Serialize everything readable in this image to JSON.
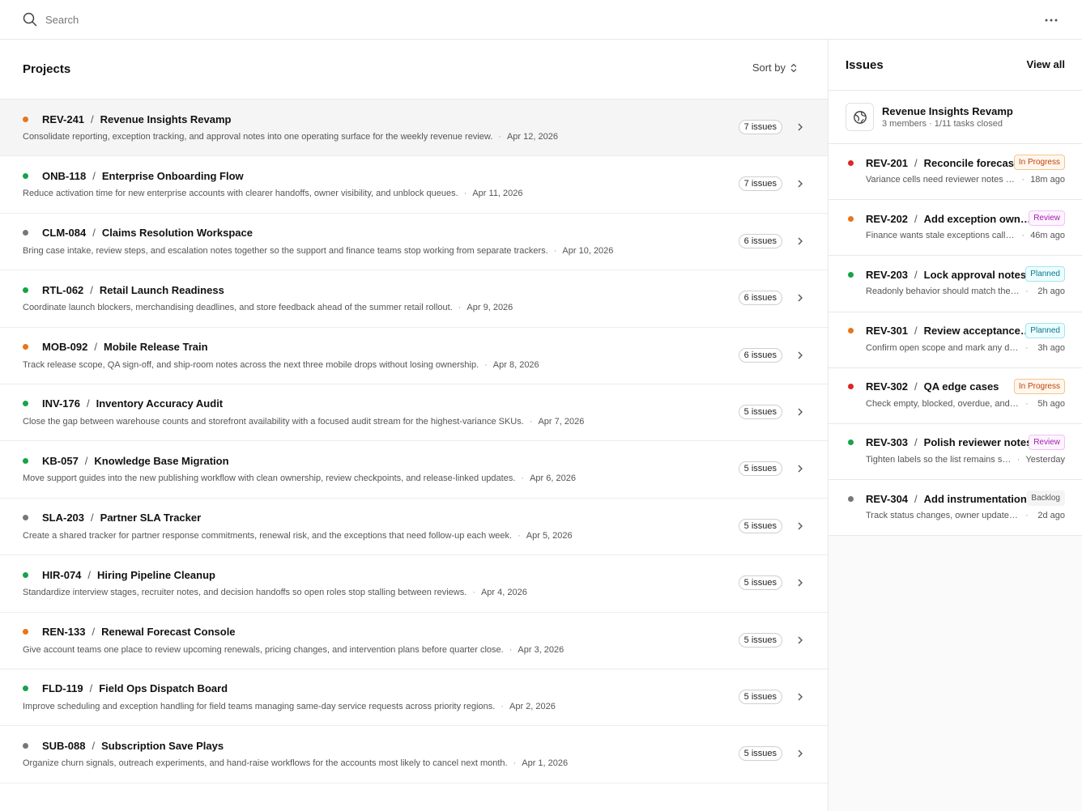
{
  "search": {
    "placeholder": "Search"
  },
  "projects": {
    "title": "Projects",
    "sort_label": "Sort by",
    "rows": [
      {
        "id": "REV-241",
        "name": "Revenue Insights Revamp",
        "desc": "Consolidate reporting, exception tracking, and approval notes into one operating surface for the weekly revenue review.",
        "date": "Apr 12, 2026",
        "issues": "7 issues",
        "dot": "#e8751a",
        "active": true
      },
      {
        "id": "ONB-118",
        "name": "Enterprise Onboarding Flow",
        "desc": "Reduce activation time for new enterprise accounts with clearer handoffs, owner visibility, and unblock queues.",
        "date": "Apr 11, 2026",
        "issues": "7 issues",
        "dot": "#16a34a"
      },
      {
        "id": "CLM-084",
        "name": "Claims Resolution Workspace",
        "desc": "Bring case intake, review steps, and escalation notes together so the support and finance teams stop working from separate trackers.",
        "date": "Apr 10, 2026",
        "issues": "6 issues",
        "dot": "#777777"
      },
      {
        "id": "RTL-062",
        "name": "Retail Launch Readiness",
        "desc": "Coordinate launch blockers, merchandising deadlines, and store feedback ahead of the summer retail rollout.",
        "date": "Apr 9, 2026",
        "issues": "6 issues",
        "dot": "#16a34a"
      },
      {
        "id": "MOB-092",
        "name": "Mobile Release Train",
        "desc": "Track release scope, QA sign-off, and ship-room notes across the next three mobile drops without losing ownership.",
        "date": "Apr 8, 2026",
        "issues": "6 issues",
        "dot": "#e8751a"
      },
      {
        "id": "INV-176",
        "name": "Inventory Accuracy Audit",
        "desc": "Close the gap between warehouse counts and storefront availability with a focused audit stream for the highest-variance SKUs.",
        "date": "Apr 7, 2026",
        "issues": "5 issues",
        "dot": "#16a34a"
      },
      {
        "id": "KB-057",
        "name": "Knowledge Base Migration",
        "desc": "Move support guides into the new publishing workflow with clean ownership, review checkpoints, and release-linked updates.",
        "date": "Apr 6, 2026",
        "issues": "5 issues",
        "dot": "#16a34a"
      },
      {
        "id": "SLA-203",
        "name": "Partner SLA Tracker",
        "desc": "Create a shared tracker for partner response commitments, renewal risk, and the exceptions that need follow-up each week.",
        "date": "Apr 5, 2026",
        "issues": "5 issues",
        "dot": "#777777"
      },
      {
        "id": "HIR-074",
        "name": "Hiring Pipeline Cleanup",
        "desc": "Standardize interview stages, recruiter notes, and decision handoffs so open roles stop stalling between reviews.",
        "date": "Apr 4, 2026",
        "issues": "5 issues",
        "dot": "#16a34a"
      },
      {
        "id": "REN-133",
        "name": "Renewal Forecast Console",
        "desc": "Give account teams one place to review upcoming renewals, pricing changes, and intervention plans before quarter close.",
        "date": "Apr 3, 2026",
        "issues": "5 issues",
        "dot": "#e8751a"
      },
      {
        "id": "FLD-119",
        "name": "Field Ops Dispatch Board",
        "desc": "Improve scheduling and exception handling for field teams managing same-day service requests across priority regions.",
        "date": "Apr 2, 2026",
        "issues": "5 issues",
        "dot": "#16a34a"
      },
      {
        "id": "SUB-088",
        "name": "Subscription Save Plays",
        "desc": "Organize churn signals, outreach experiments, and hand-raise workflows for the accounts most likely to cancel next month.",
        "date": "Apr 1, 2026",
        "issues": "5 issues",
        "dot": "#777777"
      }
    ]
  },
  "issues": {
    "title": "Issues",
    "view_all": "View all",
    "project": {
      "name": "Revenue Insights Revamp",
      "meta": "3 members · 1/11 tasks closed"
    },
    "items": [
      {
        "id": "REV-201",
        "title": "Reconcile forecast variance",
        "snippet": "Variance cells need reviewer notes before sign-off",
        "time": "18m ago",
        "status": "In Progress",
        "dot": "#dc2626",
        "badge_color": "#c2410c",
        "badge_bg": "#fff7ed",
        "badge_border": "#f5c48f"
      },
      {
        "id": "REV-202",
        "title": "Add exception owner column",
        "snippet": "Finance wants stale exceptions called out",
        "time": "46m ago",
        "status": "Review",
        "dot": "#e8751a",
        "badge_color": "#a21caf",
        "badge_bg": "#fdf4ff",
        "badge_border": "#f0c2f5"
      },
      {
        "id": "REV-203",
        "title": "Lock approval notes",
        "snippet": "Readonly behavior should match the audit view",
        "time": "2h ago",
        "status": "Planned",
        "dot": "#16a34a",
        "badge_color": "#0e7490",
        "badge_bg": "#ecfeff",
        "badge_border": "#a5e4ee"
      },
      {
        "id": "REV-301",
        "title": "Review acceptance criteria",
        "snippet": "Confirm open scope and mark any deferred items",
        "time": "3h ago",
        "status": "Planned",
        "dot": "#e8751a",
        "badge_color": "#0e7490",
        "badge_bg": "#ecfeff",
        "badge_border": "#a5e4ee"
      },
      {
        "id": "REV-302",
        "title": "QA edge cases",
        "snippet": "Check empty, blocked, overdue, and reassigned states",
        "time": "5h ago",
        "status": "In Progress",
        "dot": "#dc2626",
        "badge_color": "#c2410c",
        "badge_bg": "#fff7ed",
        "badge_border": "#f5c48f"
      },
      {
        "id": "REV-303",
        "title": "Polish reviewer notes",
        "snippet": "Tighten labels so the list remains scannable",
        "time": "Yesterday",
        "status": "Review",
        "dot": "#16a34a",
        "badge_color": "#a21caf",
        "badge_bg": "#fdf4ff",
        "badge_border": "#f0c2f5"
      },
      {
        "id": "REV-304",
        "title": "Add instrumentation",
        "snippet": "Track status changes, owner updates, and exports",
        "time": "2d ago",
        "status": "Backlog",
        "dot": "#777777",
        "badge_color": "#555555",
        "badge_bg": "#f4f4f5",
        "badge_border": "#f4f4f5"
      }
    ]
  }
}
